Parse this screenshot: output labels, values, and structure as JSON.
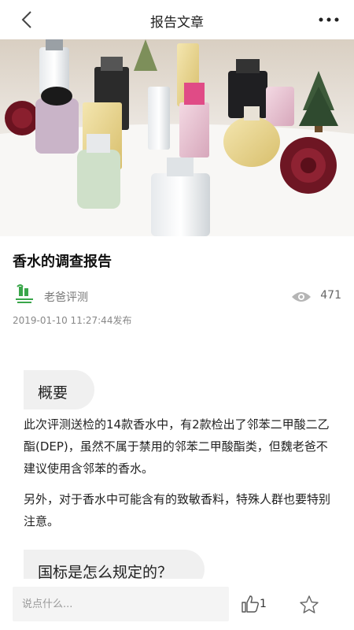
{
  "header": {
    "title": "报告文章",
    "back_icon": "back-chevron-icon",
    "more_icon": "more-dots-icon"
  },
  "article": {
    "title": "香水的调查报告",
    "author": "老爸评测",
    "view_count": "471",
    "publish_time": "2019-01-10 11:27:44发布"
  },
  "sections": [
    {
      "heading": "概要",
      "paragraphs": [
        "此次评测送检的14款香水中，有2款检出了邻苯二甲酸二乙酯(DEP)，虽然不属于禁用的邻苯二甲酸酯类，但魏老爸不建议使用含邻苯的香水。",
        "另外，对于香水中可能含有的致敏香料，特殊人群也要特别注意。"
      ]
    },
    {
      "heading": "国标是怎么规定的？"
    }
  ],
  "bottom_bar": {
    "comment_placeholder": "说点什么...",
    "like_count": "1",
    "like_icon": "thumbs-up-icon",
    "favorite_icon": "star-icon"
  },
  "colors": {
    "section_bg": "#f0f0f0",
    "text": "#222222",
    "muted": "#888888",
    "logo_green": "#3aa64a"
  }
}
